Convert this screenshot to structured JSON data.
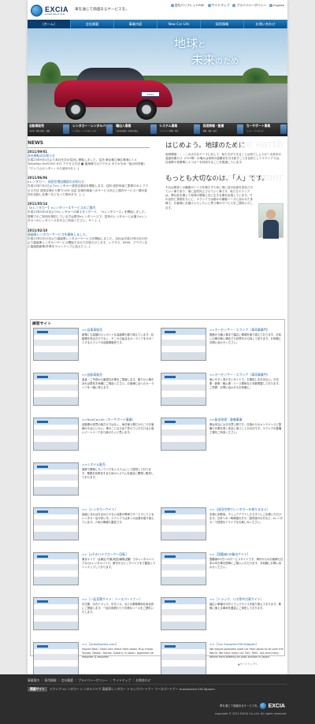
{
  "header": {
    "logo": "EXCIA",
    "logo_sub": "CORPORATION",
    "tagline": "車を通じて価値あるサービスを。",
    "toplinks": [
      "会社パンフレットPDF",
      "サイトマップ",
      "プライバシーポリシー",
      "English"
    ]
  },
  "nav": [
    "［ホーム］",
    "会社概要",
    "事業内容",
    "New Car Life",
    "採用情報",
    "お問い合わせ"
  ],
  "hero": {
    "line1_a": "地球",
    "line1_b": "と",
    "line2_a": "未来",
    "line2_b": "のため",
    "plate": "EXCIA Exporter"
  },
  "tiles": [
    {
      "title": "自動車販売",
      "sub": "中古車・新車の販売・買取"
    },
    {
      "title": "レンタカー・レンタルバイク",
      "sub": "レンタカー・バイクのレンタル"
    },
    {
      "title": "輸出入事業",
      "sub": "日本車の輸出・海外車の輸入"
    },
    {
      "title": "システム事業",
      "sub": "ソフトウェア開発・販売"
    },
    {
      "title": "採用情報・整備",
      "sub": "整備・車検・板金"
    },
    {
      "title": "カーサポート事業",
      "sub": "リース・ドライビング"
    }
  ],
  "news": {
    "heading": "NEWS",
    "items": [
      {
        "date": "2011/09/01",
        "title": "本社移転のお知らせ",
        "body": "平成23年9月1日より本社を次の住所に移転しました。住所 東京都江東区青海2-7-4 TokyoBay theSOHO 812 アクセス方法 ■ 臨海線でのアクセス ゆりかもめ「船の科学館」「テレコムセンター」から徒歩5分 [...]"
      },
      {
        "date": "2011/06/06",
        "title": "eレンタカー、成田空港店開設のお知らせ",
        "body": "平成23年7月1日よりeレンタカー成田空港店を開設します。住所 成田市南三里塚226-1 アクセス方法 成田空港から車で10分 当店 空港利用者へのサービス向上と国内サービス一層の拡充を目指し社員一丸となって努めます。[...]"
      },
      {
        "date": "2011/05/14",
        "title": "【eレンタカー】eレンタリースサービスのご案内",
        "body": "平成23年5月16日よりeレンタカーの新スタンダード、「eレンタリース」を開始しました。長期でのご利用を検討している方は是非eレンタリースで、従来のレンタカーとは違うeレンタカーのレンタリースをぜひご利用ください。サー [...]"
      },
      {
        "date": "2011/02/10",
        "title": "高級車レンタカーサービスを開始しました。",
        "body": "平成23年2月10日より高級車レンタカーサービスを開始しました。当社は平成23年2月10日より高級車レンタカーサービス開始するのでお知らせします。レクサス、BMW、アウディなど高級国産車/外車をラインナップに加えた [...]"
      }
    ]
  },
  "about": {
    "h1": "はじめよう。地球のために",
    "bg1": "the earth",
    "p1": "地球環境・・・この大きなテーマに対して、私たちができることは何でしょうか？大気中の温室効果ガス（CO2等）の増大は地球の温暖化を引き起すことを目的としてエクシアでは、社用車や営業車にエコカーを利用することを推進しています。",
    "h2": "もっとも大切なのは、「人」です。",
    "bg2": "For customer",
    "p2": "それは数多くの顧客のニーズを満たすために常に自分自身を変化させていく事であり、常に品質向上させていく事です。私たちエクシアは、車社会を通して地球の環境と共に生きる事を目指しています。その目的と実現をもとに、エクシアでは個々の顧客ニーズに合わせた多様で、お客様にお届けいたしたいと思う車のサービスをご提供いたします。"
  },
  "related": {
    "heading": "練習サイト",
    "items": [
      {
        "title": ">>自車車販売",
        "desc": "新車にも高額のエレガントな高級車も取り揃えています。目動車を売るだけでなく、そこから始まるカーライフをサポートするエクシアの自動車販売です。"
      },
      {
        "title": ">>カーセンサー・エクシア（車両事業門）",
        "desc": "国産から輸入車まで幅広い車種を取り揃えております。お探しの車が無い場合でも世界中から探して参ります。お気軽にお問い合わせください。"
      },
      {
        "title": ">>自販車販売",
        "desc": "用途・ご予算から最適なお車をご提案します。乗りたい車があれば是非お気軽にご相談ください。お客様に合ったカーライフを一緒に考えます。"
      },
      {
        "title": ">>カーセンサー・エクシア（車両事業門）",
        "desc": "使いやすく見やすいサイトで、お車探しをお手伝い。中古車・新車・輸入車・リース車両など多数掲載しております。ご質問・お問い合わせもお気軽に。"
      },
      {
        "title": ">>NewCarLife（カーサポート事業）",
        "desc": "自動車の売買の時だけではなく、毎日使う車だからこそお客様のそばにいたい。車のことなら全て任せていただける心強いパートナーであり続けたいと思います。"
      },
      {
        "title": ">>板金修理・整備事業",
        "desc": "車は本当に大きな買い物です。日頃からのメンテナンスと整備でお車を長く安全に保つことが大切です。エクシアの整備工場をご利用ください。"
      },
      {
        "title": ">>システム販売",
        "desc": "実際で蓄積したノウハウをシステムにして提供しております。業務を効率化するためのシステムを独自に開発し販売しております。"
      },
      {
        "title": ">>［レンタカーサイト］",
        "desc": "高級になればなるほど少ない台数の車両でサービスしているレンタカー店が多い中、エクシアでは多くの台数を取り揃えています。人気の車種も豊富です。"
      },
      {
        "title": ">>［成田空港でレンタカーを借りるなら］",
        "desc": "空港に到着後、チェックアウトしたらすぐにご出発いただけます。日本への一時帰国の方や、国内旅行の方など、eレンタカーで快適なドライブをお楽しみください。"
      },
      {
        "title": ">>［eそのバイクスーサー回転］",
        "desc": "東京エリア（台東区/千葉/成田/練馬店舗）でのレンタルバイクならeレンタルバイク。原付からビッグバイクまで豊富にラインナップしております。"
      },
      {
        "title": ">>［国籍者Eの輸出サイト］",
        "desc": "国籍者Eの方へのサービスサイトです。海外からのお客様も日本の中古車を簡単にご購入いただけます。お気軽にお問い合わせください。"
      },
      {
        "title": ">>［一括見積サイト：リースパートナー］",
        "desc": "中古車、中古トラック、中古バス、などの業務車両を総合的にご提案します。一括お見積もりでお得なリースをご提供いたします。"
      },
      {
        "title": ">>［トラック、バス等中古車サイト］",
        "desc": "幅広い車種の中古トラックやバスを取り揃えております。業務に使える車両を豊富にご用意しております。"
      },
      {
        "title": ">>［AutoAssista.com］",
        "desc": "Import New / Used cars direct from Japan. Buy cheap Toyota, Nissan, Honda, Subaru, in Japan. Japanese car importer & exporter."
      },
      {
        "title": ">>［Car Exporter:EXCIAJapan］",
        "desc": "We export Japanese used car from Japan to all over the World. We have many car SUV, MUV, Van and many others from bidding on auto auction in Japan."
      }
    ]
  },
  "pagetop": "▲ページトップへ",
  "footer": {
    "links1": "事業案内 ｜ 採用情報 ｜ 会社概要 ｜ プライバシーポリシー ｜ サイトマップ ｜ お問合わせ",
    "links2_label": "関連サイト",
    "links2": "エクシア eレンタカー レンタルバイク 高級車レンタカー トラックパートナー リースパートナー AutoAssista EXCIAJapan",
    "tag": "車を通じて価値あるサービスを。",
    "logo": "EXCIA",
    "copy": "copyright © 2011 EXCIA Co.,Ltd. All rights reserved."
  }
}
